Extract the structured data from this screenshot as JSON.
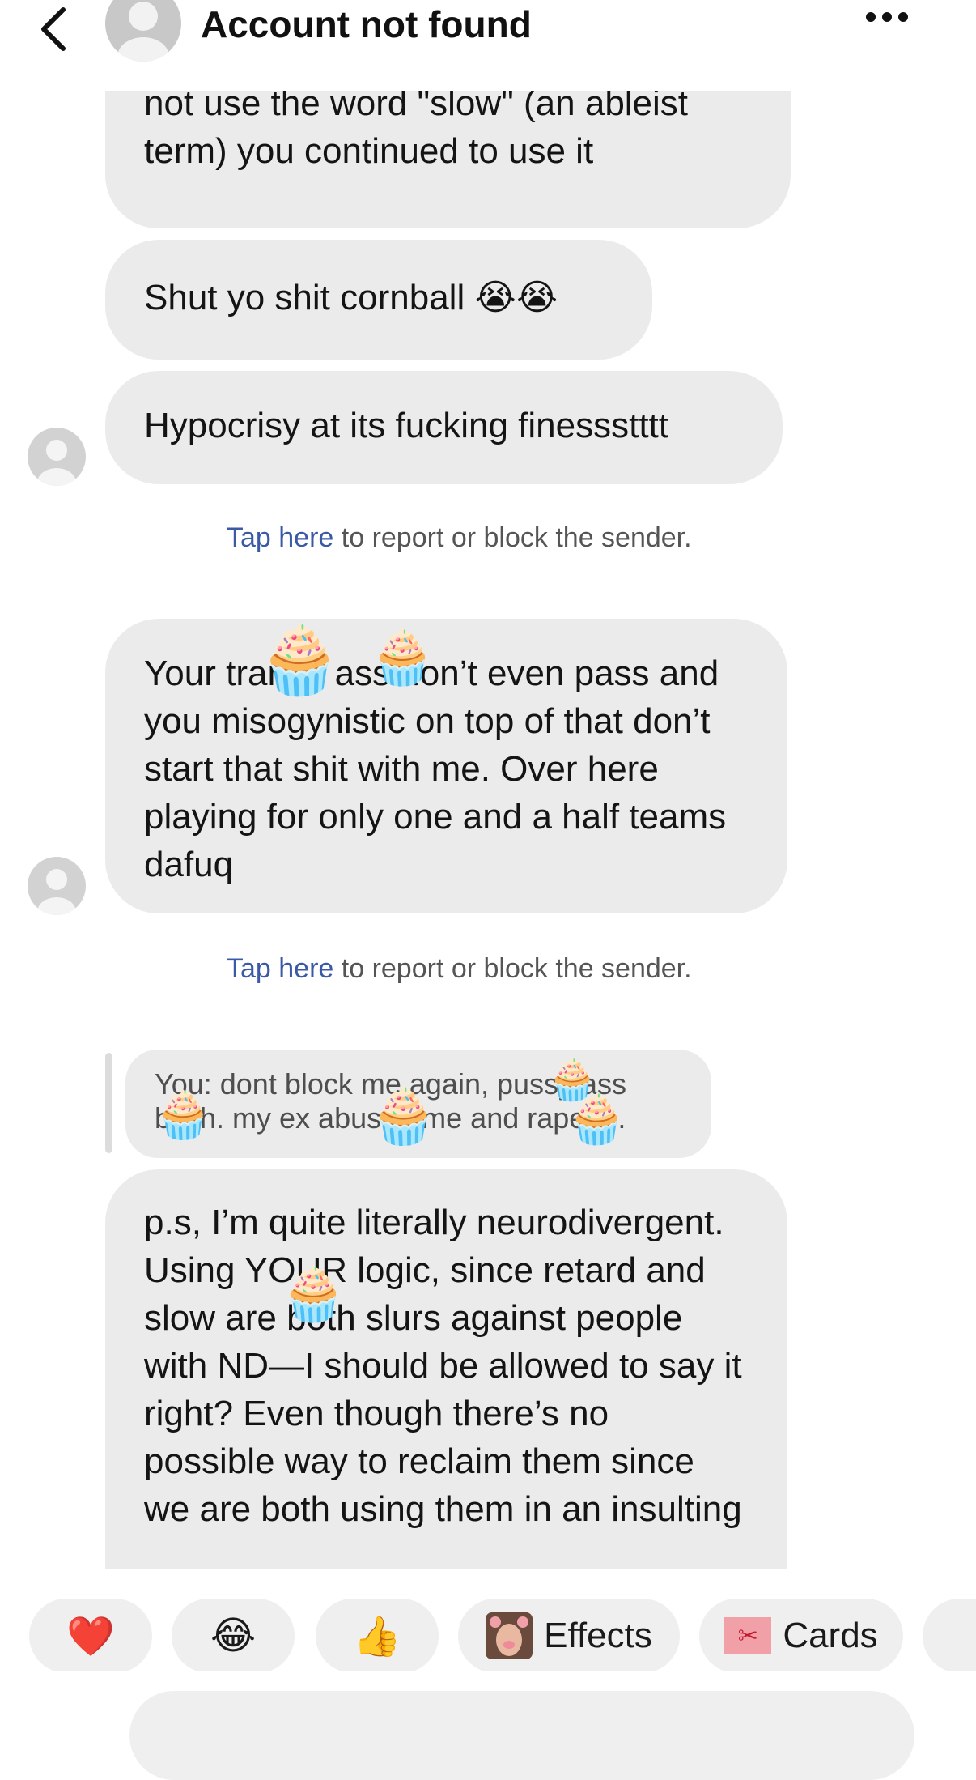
{
  "header": {
    "title": "Account not found",
    "back_icon": "chevron-left-icon",
    "more_icon": "ellipsis-icon"
  },
  "messages": [
    {
      "text": "not use the word \"slow\" (an ableist term) you continued to use it"
    },
    {
      "text": "Shut yo shit cornball 😭😭"
    },
    {
      "text": "Hypocrisy at its fucking finessstttt"
    },
    {
      "text": "Your tranny ass don’t even pass and you misogynistic on top of that don’t start that shit with me. Over here playing for only one and a half teams dafuq"
    },
    {
      "text": "p.s, I’m quite literally neurodivergent. Using YOUR logic, since retard and slow are both slurs against people with ND—I should be allowed to say it right? Even though there’s no possible way to reclaim them since we are both using them in an insulting"
    }
  ],
  "report_notice": {
    "link": "Tap here",
    "rest": " to report or block the sender."
  },
  "reply_preview": {
    "text": "You: dont block me again, pussy ass bitch. my ex abused me and raped..."
  },
  "overlay_emoji": "🧁",
  "reactions": [
    {
      "label": "❤️",
      "icon": "heart-icon"
    },
    {
      "label": "😂",
      "icon": "laughing-emoji-icon"
    },
    {
      "label": "👍",
      "icon": "thumbs-up-icon"
    },
    {
      "label": "Effects",
      "icon": "effects-thumbnail-icon"
    },
    {
      "label": "Cards",
      "icon": "cards-thumbnail-icon"
    }
  ],
  "colors": {
    "bubble": "#ebebeb",
    "link": "#3b5aa6",
    "background": "#ffffff"
  }
}
